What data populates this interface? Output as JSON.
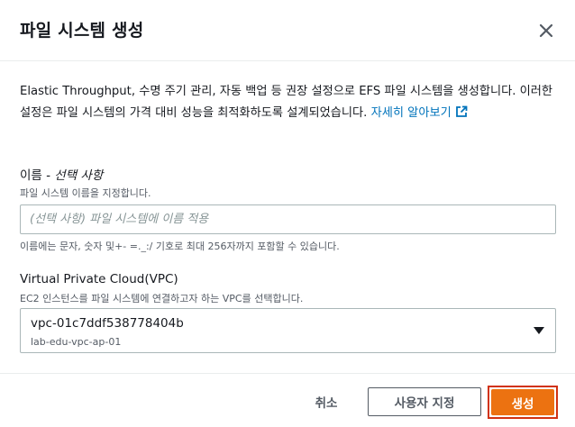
{
  "modal": {
    "title": "파일 시스템 생성",
    "close_icon": "close-icon"
  },
  "description": {
    "text": "Elastic Throughput, 수명 주기 관리, 자동 백업 등 권장 설정으로 EFS 파일 시스템을 생성합니다. 이러한 설정은 파일 시스템의 가격 대비 성능을 최적화하도록 설계되었습니다.",
    "link_text": "자세히 알아보기",
    "link_icon": "external-link-icon",
    "link_color": "#0073bb"
  },
  "name_field": {
    "label": "이름",
    "label_optional": " - 선택 사항",
    "description": "파일 시스템 이름을 지정합니다.",
    "placeholder": "(선택 사항) 파일 시스템에 이름 적용",
    "value": "",
    "constraint": "이름에는 문자, 숫자 및+- =._:/ 기호로 최대 256자까지 포함할 수 있습니다."
  },
  "vpc_field": {
    "label": "Virtual Private Cloud(VPC)",
    "description": "EC2 인스턴스를 파일 시스템에 연결하고자 하는 VPC를 선택합니다.",
    "selected_id": "vpc-01c7ddf538778404b",
    "selected_name": "lab-edu-vpc-ap-01",
    "caret_icon": "caret-down-icon"
  },
  "footer": {
    "cancel_label": "취소",
    "custom_label": "사용자 지정",
    "create_label": "생성",
    "primary_color": "#ec7211",
    "highlight_color": "#d13212"
  }
}
